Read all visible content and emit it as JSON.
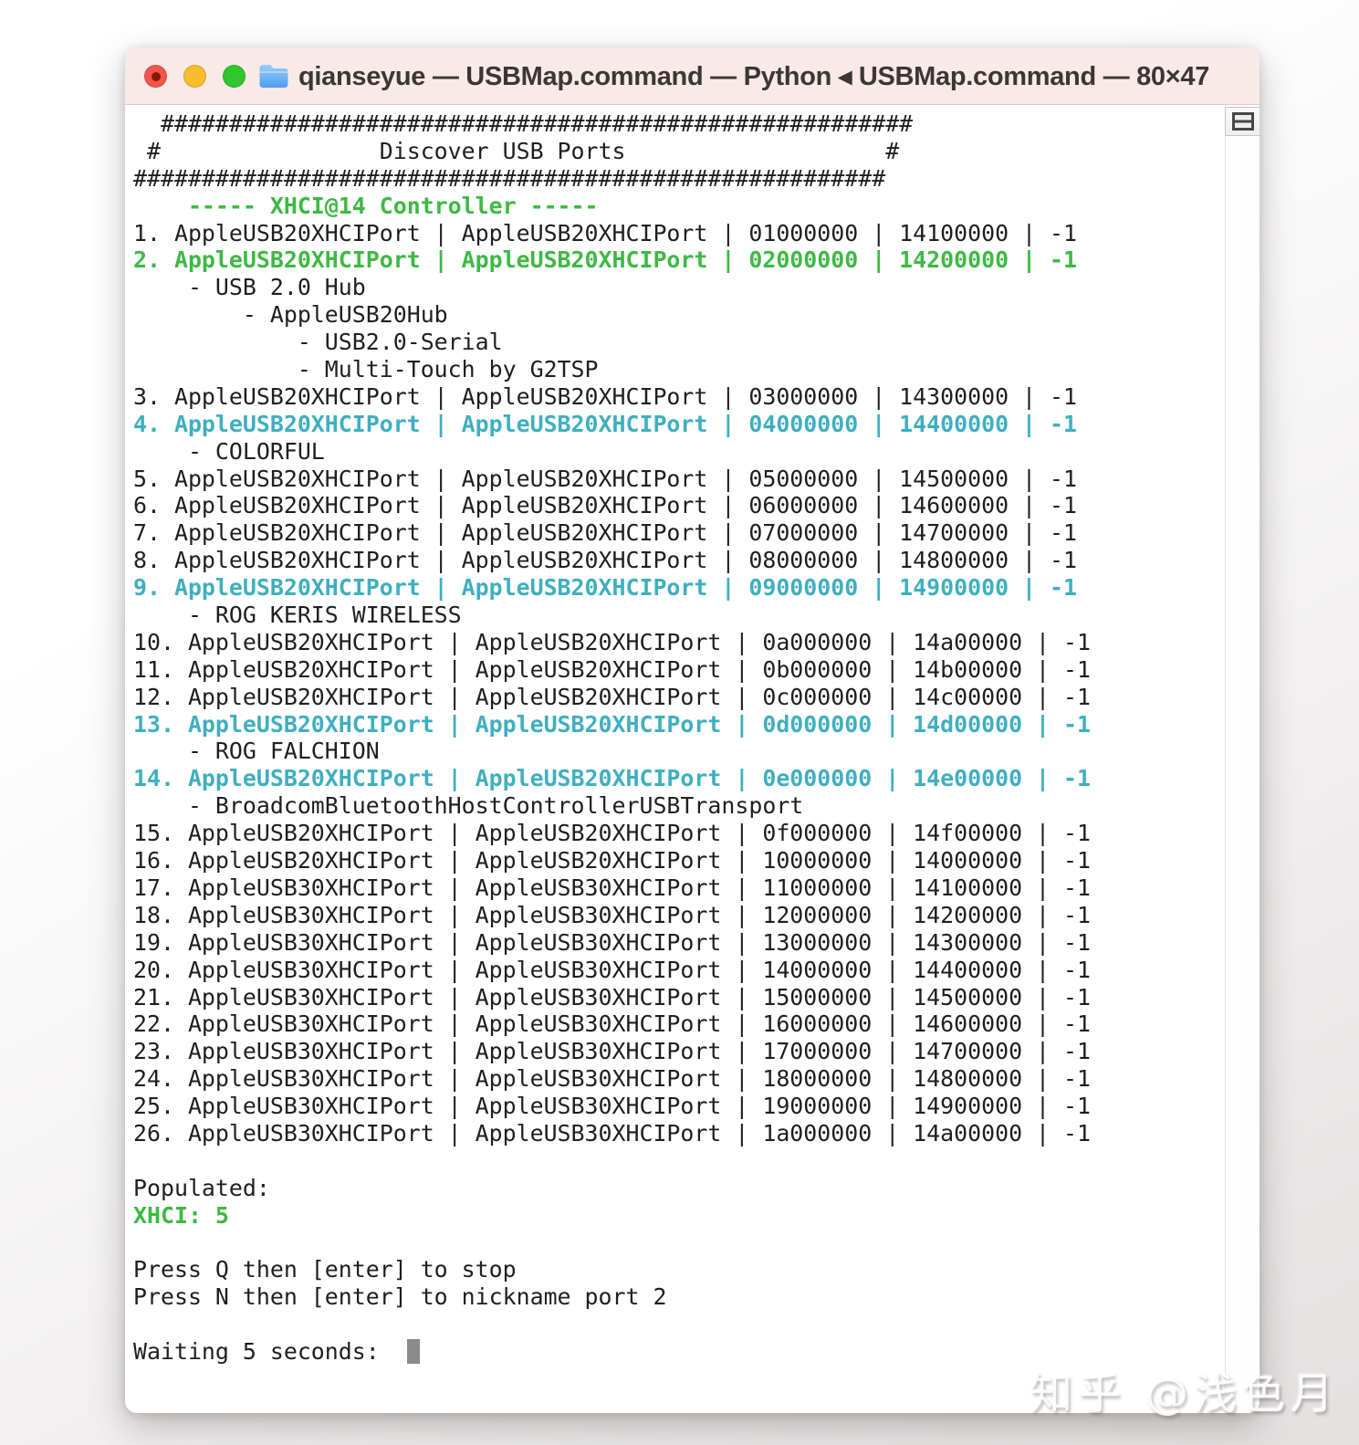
{
  "window": {
    "title": "qianseyue — USBMap.command — Python ◂ USBMap.command — 80×47"
  },
  "terminal": {
    "lines": [
      {
        "segs": [
          [
            "  #######################################################",
            "d"
          ]
        ]
      },
      {
        "segs": [
          [
            " #                Discover USB Ports                   #",
            "d"
          ]
        ]
      },
      {
        "segs": [
          [
            "#######################################################",
            "d"
          ]
        ]
      },
      {
        "segs": [
          [
            "    ----- XHCI@14 Controller -----",
            "g"
          ]
        ]
      },
      {
        "segs": [
          [
            "1. AppleUSB20XHCIPort | AppleUSB20XHCIPort | 01000000 | 14100000 | -1",
            "d"
          ]
        ]
      },
      {
        "segs": [
          [
            "2. AppleUSB20XHCIPort | AppleUSB20XHCIPort | 02000000 | 14200000 | -1",
            "g"
          ]
        ]
      },
      {
        "segs": [
          [
            "    - USB 2.0 Hub",
            "d"
          ]
        ]
      },
      {
        "segs": [
          [
            "        - AppleUSB20Hub",
            "d"
          ]
        ]
      },
      {
        "segs": [
          [
            "            - USB2.0-Serial",
            "d"
          ]
        ]
      },
      {
        "segs": [
          [
            "            - Multi-Touch by G2TSP",
            "d"
          ]
        ]
      },
      {
        "segs": [
          [
            "3. AppleUSB20XHCIPort | AppleUSB20XHCIPort | 03000000 | 14300000 | -1",
            "d"
          ]
        ]
      },
      {
        "segs": [
          [
            "4. AppleUSB20XHCIPort | AppleUSB20XHCIPort | 04000000 | 14400000 | -1",
            "c"
          ]
        ]
      },
      {
        "segs": [
          [
            "    - COLORFUL",
            "d"
          ]
        ]
      },
      {
        "segs": [
          [
            "5. AppleUSB20XHCIPort | AppleUSB20XHCIPort | 05000000 | 14500000 | -1",
            "d"
          ]
        ]
      },
      {
        "segs": [
          [
            "6. AppleUSB20XHCIPort | AppleUSB20XHCIPort | 06000000 | 14600000 | -1",
            "d"
          ]
        ]
      },
      {
        "segs": [
          [
            "7. AppleUSB20XHCIPort | AppleUSB20XHCIPort | 07000000 | 14700000 | -1",
            "d"
          ]
        ]
      },
      {
        "segs": [
          [
            "8. AppleUSB20XHCIPort | AppleUSB20XHCIPort | 08000000 | 14800000 | -1",
            "d"
          ]
        ]
      },
      {
        "segs": [
          [
            "9. AppleUSB20XHCIPort | AppleUSB20XHCIPort | 09000000 | 14900000 | -1",
            "c"
          ]
        ]
      },
      {
        "segs": [
          [
            "    - ROG KERIS WIRELESS",
            "d"
          ]
        ]
      },
      {
        "segs": [
          [
            "10. AppleUSB20XHCIPort | AppleUSB20XHCIPort | 0a000000 | 14a00000 | -1",
            "d"
          ]
        ]
      },
      {
        "segs": [
          [
            "11. AppleUSB20XHCIPort | AppleUSB20XHCIPort | 0b000000 | 14b00000 | -1",
            "d"
          ]
        ]
      },
      {
        "segs": [
          [
            "12. AppleUSB20XHCIPort | AppleUSB20XHCIPort | 0c000000 | 14c00000 | -1",
            "d"
          ]
        ]
      },
      {
        "segs": [
          [
            "13. AppleUSB20XHCIPort | AppleUSB20XHCIPort | 0d000000 | 14d00000 | -1",
            "c"
          ]
        ]
      },
      {
        "segs": [
          [
            "    - ROG FALCHION",
            "d"
          ]
        ]
      },
      {
        "segs": [
          [
            "14. AppleUSB20XHCIPort | AppleUSB20XHCIPort | 0e000000 | 14e00000 | -1",
            "c"
          ]
        ]
      },
      {
        "segs": [
          [
            "    - BroadcomBluetoothHostControllerUSBTransport",
            "d"
          ]
        ]
      },
      {
        "segs": [
          [
            "15. AppleUSB20XHCIPort | AppleUSB20XHCIPort | 0f000000 | 14f00000 | -1",
            "d"
          ]
        ]
      },
      {
        "segs": [
          [
            "16. AppleUSB20XHCIPort | AppleUSB20XHCIPort | 10000000 | 14000000 | -1",
            "d"
          ]
        ]
      },
      {
        "segs": [
          [
            "17. AppleUSB30XHCIPort | AppleUSB30XHCIPort | 11000000 | 14100000 | -1",
            "d"
          ]
        ]
      },
      {
        "segs": [
          [
            "18. AppleUSB30XHCIPort | AppleUSB30XHCIPort | 12000000 | 14200000 | -1",
            "d"
          ]
        ]
      },
      {
        "segs": [
          [
            "19. AppleUSB30XHCIPort | AppleUSB30XHCIPort | 13000000 | 14300000 | -1",
            "d"
          ]
        ]
      },
      {
        "segs": [
          [
            "20. AppleUSB30XHCIPort | AppleUSB30XHCIPort | 14000000 | 14400000 | -1",
            "d"
          ]
        ]
      },
      {
        "segs": [
          [
            "21. AppleUSB30XHCIPort | AppleUSB30XHCIPort | 15000000 | 14500000 | -1",
            "d"
          ]
        ]
      },
      {
        "segs": [
          [
            "22. AppleUSB30XHCIPort | AppleUSB30XHCIPort | 16000000 | 14600000 | -1",
            "d"
          ]
        ]
      },
      {
        "segs": [
          [
            "23. AppleUSB30XHCIPort | AppleUSB30XHCIPort | 17000000 | 14700000 | -1",
            "d"
          ]
        ]
      },
      {
        "segs": [
          [
            "24. AppleUSB30XHCIPort | AppleUSB30XHCIPort | 18000000 | 14800000 | -1",
            "d"
          ]
        ]
      },
      {
        "segs": [
          [
            "25. AppleUSB30XHCIPort | AppleUSB30XHCIPort | 19000000 | 14900000 | -1",
            "d"
          ]
        ]
      },
      {
        "segs": [
          [
            "26. AppleUSB30XHCIPort | AppleUSB30XHCIPort | 1a000000 | 14a00000 | -1",
            "d"
          ]
        ]
      },
      {
        "segs": []
      },
      {
        "segs": [
          [
            "Populated:",
            "d"
          ]
        ]
      },
      {
        "segs": [
          [
            "XHCI: 5",
            "g"
          ]
        ]
      },
      {
        "segs": []
      },
      {
        "segs": [
          [
            "Press Q then [enter] to stop",
            "d"
          ]
        ]
      },
      {
        "segs": [
          [
            "Press N then [enter] to nickname port 2",
            "d"
          ]
        ]
      },
      {
        "segs": []
      },
      {
        "segs": [
          [
            "Waiting 5 seconds:  ",
            "d"
          ]
        ],
        "cursor": true
      },
      {
        "segs": []
      }
    ]
  },
  "watermark": {
    "text": "知乎 @浅色月"
  },
  "colors": {
    "text": "#1f1f1f",
    "green": "#3eb944",
    "cyan": "#3fafc0",
    "cursor": "#8a8a8a",
    "window_bg": "#ffffff",
    "titlebar_bg": "#f7eae9",
    "titlebar_border": "#d9cbca",
    "title_text": "#3c3735",
    "traffic_red": "#f2554c",
    "traffic_red_dot": "#8c150c",
    "traffic_yellow": "#f7bd2c",
    "traffic_green": "#33c52e"
  }
}
